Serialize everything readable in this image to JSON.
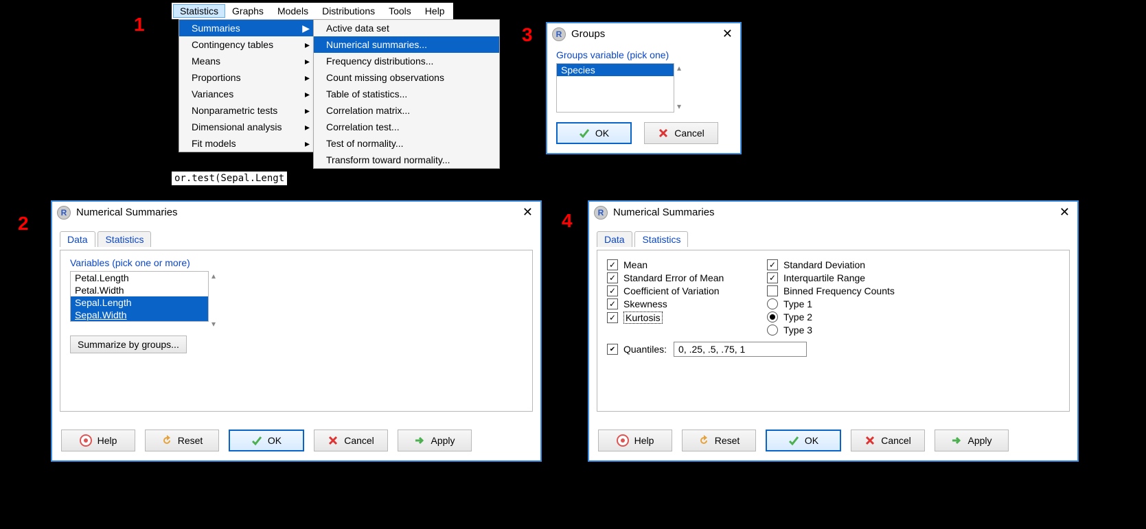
{
  "steps": {
    "s1": "1",
    "s2": "2",
    "s3": "3",
    "s4": "4"
  },
  "menubar": {
    "statistics": "Statistics",
    "graphs": "Graphs",
    "models": "Models",
    "distributions": "Distributions",
    "tools": "Tools",
    "help": "Help"
  },
  "submenu1": {
    "summaries": "Summaries",
    "contingency": "Contingency tables",
    "means": "Means",
    "proportions": "Proportions",
    "variances": "Variances",
    "nonparam": "Nonparametric tests",
    "dimanalysis": "Dimensional analysis",
    "fitmodels": "Fit models"
  },
  "submenu2": {
    "active": "Active data set",
    "numsum": "Numerical summaries...",
    "freqdist": "Frequency distributions...",
    "countmiss": "Count missing observations",
    "tablestats": "Table of statistics...",
    "corrmatrix": "Correlation matrix...",
    "corrtest": "Correlation test...",
    "normtest": "Test of normality...",
    "transform": "Transform toward normality..."
  },
  "codefrag": "or.test(Sepal.Lengt",
  "dlg2": {
    "title": "Numerical Summaries",
    "tab_data": "Data",
    "tab_stats": "Statistics",
    "vars_label": "Variables (pick one or more)",
    "vars": [
      "Petal.Length",
      "Petal.Width",
      "Sepal.Length",
      "Sepal.Width"
    ],
    "sumgroups": "Summarize by groups...",
    "help": "Help",
    "reset": "Reset",
    "ok": "OK",
    "cancel": "Cancel",
    "apply": "Apply"
  },
  "dlg3": {
    "title": "Groups",
    "label": "Groups variable (pick one)",
    "var": "Species",
    "ok": "OK",
    "cancel": "Cancel"
  },
  "dlg4": {
    "title": "Numerical Summaries",
    "tab_data": "Data",
    "tab_stats": "Statistics",
    "mean": "Mean",
    "stderr": "Standard Error of Mean",
    "cv": "Coefficient of Variation",
    "skew": "Skewness",
    "kurt": "Kurtosis",
    "sd": "Standard Deviation",
    "iqr": "Interquartile Range",
    "binned": "Binned Frequency Counts",
    "type1": "Type 1",
    "type2": "Type 2",
    "type3": "Type 3",
    "quant_label": "Quantiles:",
    "quant_value": "0, .25, .5, .75, 1",
    "help": "Help",
    "reset": "Reset",
    "ok": "OK",
    "cancel": "Cancel",
    "apply": "Apply"
  }
}
